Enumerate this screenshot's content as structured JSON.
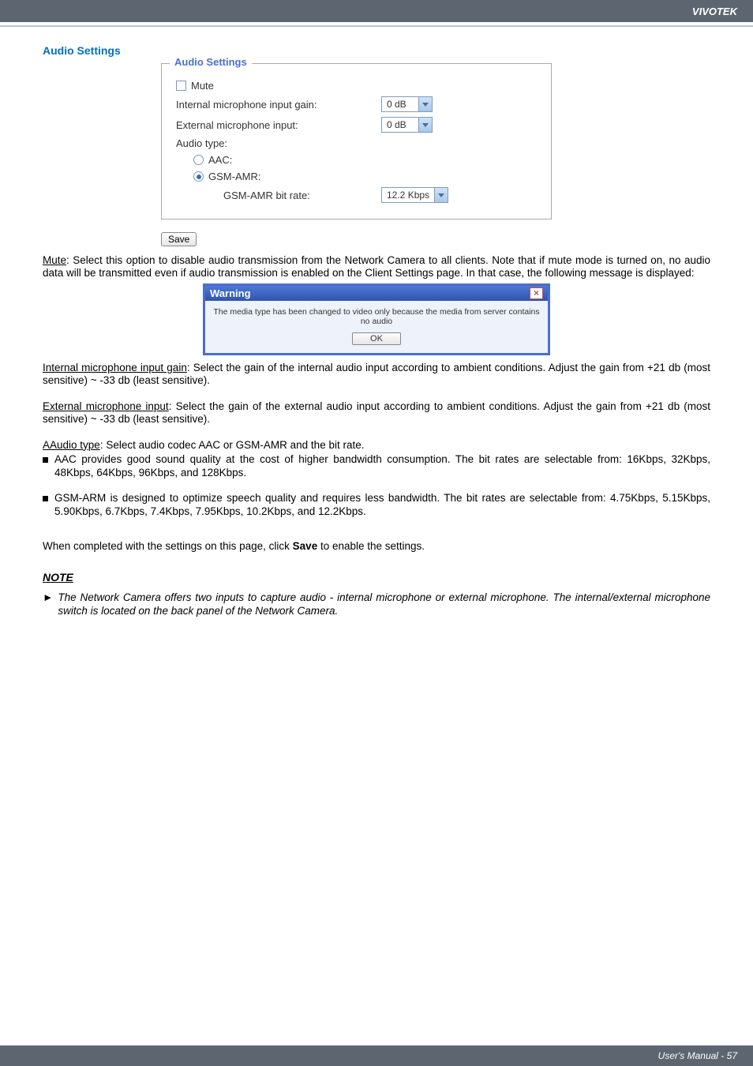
{
  "header": {
    "brand": "VIVOTEK"
  },
  "section": {
    "title": "Audio Settings"
  },
  "fieldset": {
    "legend": "Audio Settings",
    "mute_label": "Mute",
    "internal_gain_label": "Internal microphone input gain:",
    "internal_gain_value": "0 dB",
    "external_input_label": "External microphone input:",
    "external_input_value": "0 dB",
    "audio_type_label": "Audio type:",
    "aac_label": "AAC:",
    "gsm_amr_label": "GSM-AMR:",
    "gsm_bitrate_label": "GSM-AMR bit rate:",
    "gsm_bitrate_value": "12.2 Kbps"
  },
  "save_label": "Save",
  "para1_a": "Mute",
  "para1_b": ": Select this option to disable audio transmission from the Network Camera to all clients. Note that if mute mode is turned on, no audio data will be transmitted even if audio transmission is enabled on the Client Settings page. In that case, the following message is displayed:",
  "warning": {
    "title": "Warning",
    "body": "The media type has been changed to video only because the media from server contains no audio",
    "ok": "OK"
  },
  "para2_a": "Internal microphone input gain",
  "para2_b": ": Select the gain of the internal audio input according to ambient conditions. Adjust the gain from +21 db (most sensitive) ~ -33 db (least sensitive).",
  "para3_a": "External microphone input",
  "para3_b": ": Select the gain of the external audio input according to ambient conditions. Adjust the gain from +21 db (most sensitive) ~ -33 db (least sensitive).",
  "para4_a": "AAudio type",
  "para4_b": ": Select audio codec AAC or GSM-AMR and the bit rate.",
  "bul1": "AAC provides good sound quality at the cost of higher bandwidth consumption. The bit rates are selectable from: 16Kbps, 32Kbps, 48Kbps, 64Kbps, 96Kbps, and 128Kbps.",
  "bul2": "GSM-ARM is designed to optimize speech quality and requires less bandwidth. The bit rates are selectable from: 4.75Kbps, 5.15Kbps, 5.90Kbps, 6.7Kbps, 7.4Kbps, 7.95Kbps, 10.2Kbps, and 12.2Kbps.",
  "para5_a": "When completed with the settings on this page, click ",
  "para5_b": "Save",
  "para5_c": " to enable the settings.",
  "note_hd": "NOTE",
  "note_arrow": "►",
  "note_body": "The Network Camera offers two inputs to capture audio - internal microphone or external microphone. The internal/external microphone switch is located on the back panel of the Network Camera.",
  "footer": {
    "text": "User's Manual - 57"
  }
}
